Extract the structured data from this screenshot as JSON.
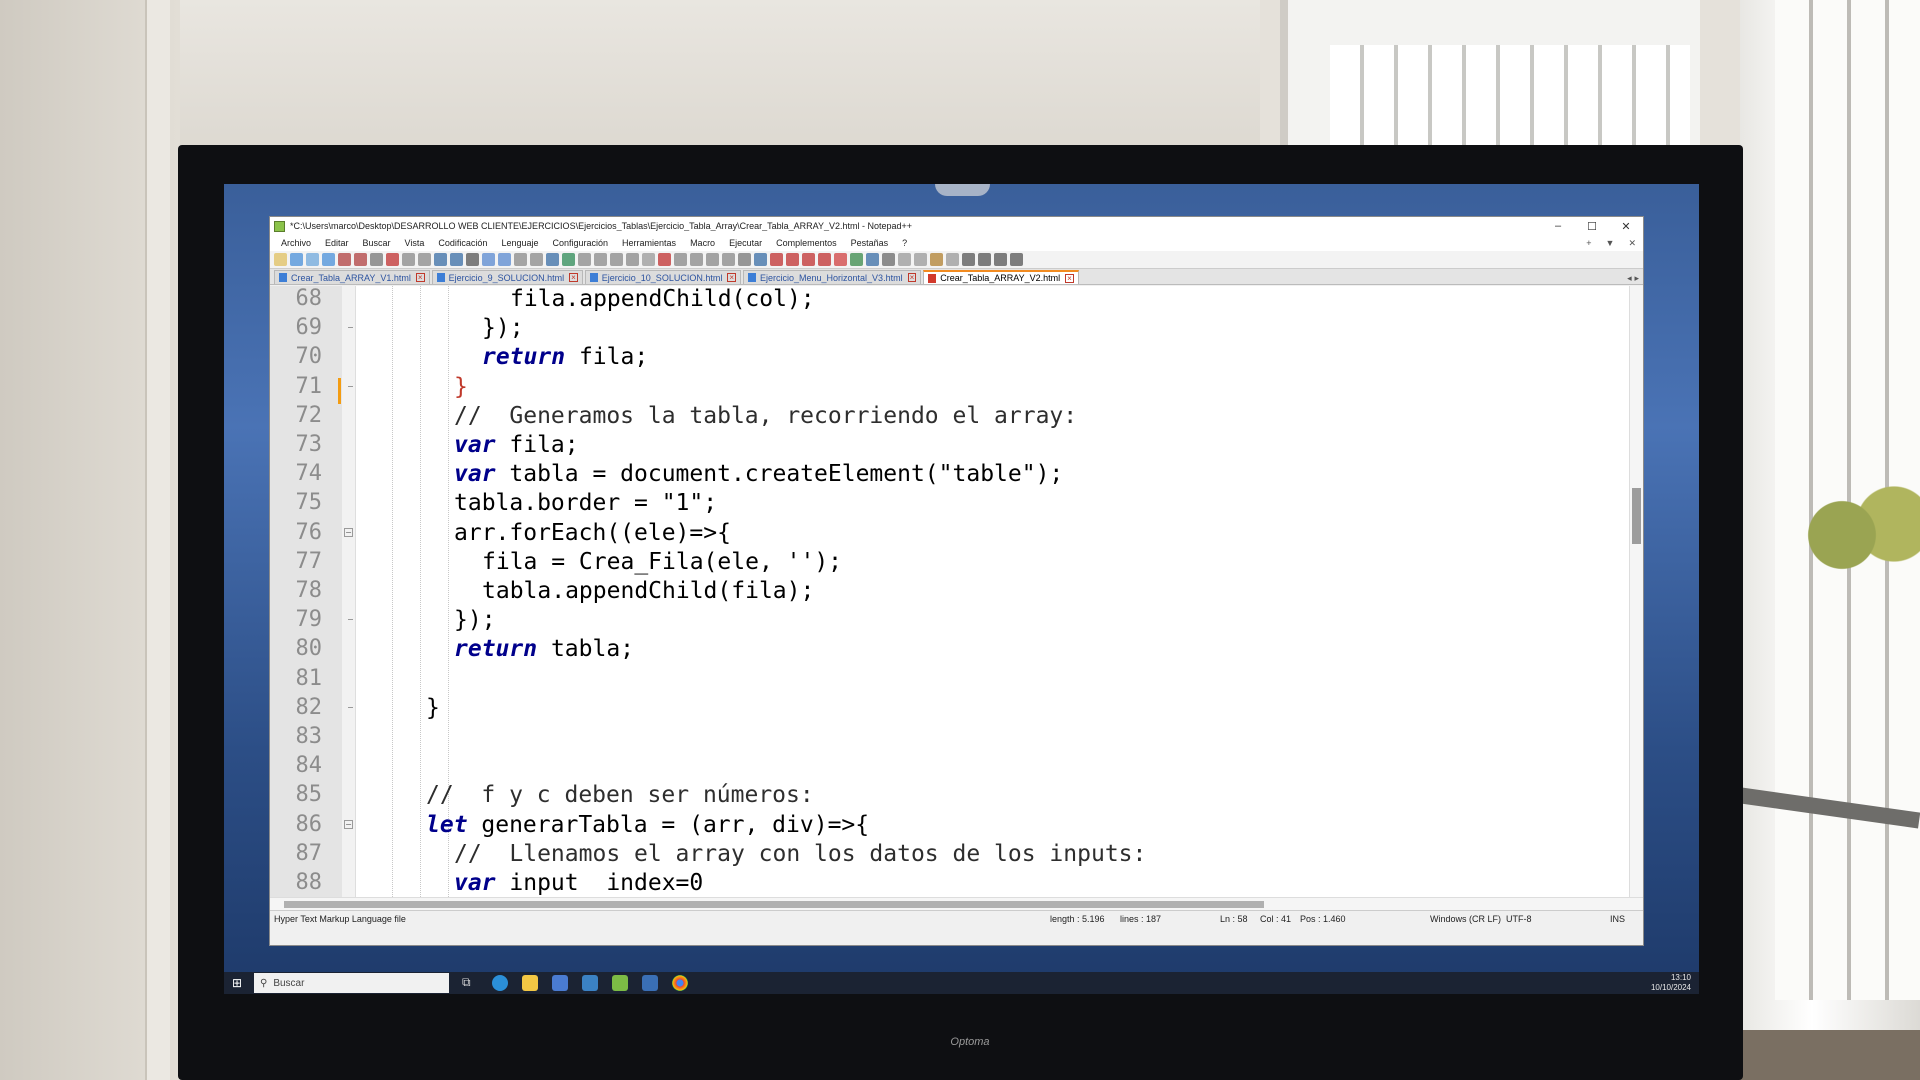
{
  "window": {
    "title": "*C:\\Users\\marco\\Desktop\\DESARROLLO WEB CLIENTE\\EJERCICIOS\\Ejercicios_Tablas\\Ejercicio_Tabla_Array\\Crear_Tabla_ARRAY_V2.html - Notepad++",
    "minimize": "–",
    "maximize": "☐",
    "close": "✕"
  },
  "menu": [
    "Archivo",
    "Editar",
    "Buscar",
    "Vista",
    "Codificación",
    "Lenguaje",
    "Configuración",
    "Herramientas",
    "Macro",
    "Ejecutar",
    "Complementos",
    "Pestañas",
    "?"
  ],
  "menu_right": [
    "+",
    "▼",
    "✕"
  ],
  "tabs": [
    {
      "label": "Crear_Tabla_ARRAY_V1.html",
      "active": false
    },
    {
      "label": "Ejercicio_9_SOLUCION.html",
      "active": false
    },
    {
      "label": "Ejercicio_10_SOLUCION.html",
      "active": false
    },
    {
      "label": "Ejercicio_Menu_Horizontal_V3.html",
      "active": false
    },
    {
      "label": "Crear_Tabla_ARRAY_V2.html",
      "active": true
    }
  ],
  "tab_nav": "◂ ▸",
  "code": [
    {
      "ln": "68",
      "indent": 3,
      "fold": "",
      "tokens": [
        {
          "t": "fila.appendChild(col);",
          "c": ""
        }
      ]
    },
    {
      "ln": "69",
      "indent": 2,
      "fold": "tick",
      "tokens": [
        {
          "t": "});",
          "c": ""
        }
      ]
    },
    {
      "ln": "70",
      "indent": 2,
      "fold": "",
      "tokens": [
        {
          "t": "return",
          "c": "kw"
        },
        {
          "t": " fila;",
          "c": ""
        }
      ]
    },
    {
      "ln": "71",
      "indent": 1,
      "fold": "tick",
      "tokens": [
        {
          "t": "}",
          "c": "brace-red"
        }
      ]
    },
    {
      "ln": "72",
      "indent": 1,
      "fold": "",
      "tokens": [
        {
          "t": "//  Generamos la tabla, recorriendo el array:",
          "c": "cm"
        }
      ]
    },
    {
      "ln": "73",
      "indent": 1,
      "fold": "",
      "tokens": [
        {
          "t": "var",
          "c": "kw"
        },
        {
          "t": " fila;",
          "c": ""
        }
      ]
    },
    {
      "ln": "74",
      "indent": 1,
      "fold": "",
      "tokens": [
        {
          "t": "var",
          "c": "kw"
        },
        {
          "t": " tabla = document.createElement(\"table\");",
          "c": ""
        }
      ]
    },
    {
      "ln": "75",
      "indent": 1,
      "fold": "",
      "tokens": [
        {
          "t": "tabla.border = \"1\";",
          "c": ""
        }
      ]
    },
    {
      "ln": "76",
      "indent": 1,
      "fold": "box",
      "tokens": [
        {
          "t": "arr.forEach((ele)=>{",
          "c": ""
        }
      ]
    },
    {
      "ln": "77",
      "indent": 2,
      "fold": "",
      "tokens": [
        {
          "t": "fila = Crea_Fila(ele, '');",
          "c": ""
        }
      ]
    },
    {
      "ln": "78",
      "indent": 2,
      "fold": "",
      "tokens": [
        {
          "t": "tabla.appendChild(fila);",
          "c": ""
        }
      ]
    },
    {
      "ln": "79",
      "indent": 1,
      "fold": "tick",
      "tokens": [
        {
          "t": "});",
          "c": ""
        }
      ]
    },
    {
      "ln": "80",
      "indent": 1,
      "fold": "",
      "tokens": [
        {
          "t": "return",
          "c": "kw"
        },
        {
          "t": " tabla;",
          "c": ""
        }
      ]
    },
    {
      "ln": "81",
      "indent": 0,
      "fold": "",
      "tokens": []
    },
    {
      "ln": "82",
      "indent": 0,
      "fold": "tick",
      "tokens": [
        {
          "t": "}",
          "c": ""
        }
      ]
    },
    {
      "ln": "83",
      "indent": 0,
      "fold": "",
      "tokens": []
    },
    {
      "ln": "84",
      "indent": 0,
      "fold": "",
      "tokens": []
    },
    {
      "ln": "85",
      "indent": 0,
      "fold": "",
      "tokens": [
        {
          "t": "//  f y c deben ser números:",
          "c": "cm"
        }
      ]
    },
    {
      "ln": "86",
      "indent": 0,
      "fold": "box",
      "tokens": [
        {
          "t": "let",
          "c": "kw"
        },
        {
          "t": " generarTabla = (arr, div)=>{",
          "c": ""
        }
      ]
    },
    {
      "ln": "87",
      "indent": 1,
      "fold": "",
      "tokens": [
        {
          "t": "//  Llenamos el array con los datos de los inputs:",
          "c": "cm"
        }
      ]
    },
    {
      "ln": "88",
      "indent": 1,
      "fold": "",
      "tokens": [
        {
          "t": "var",
          "c": "kw"
        },
        {
          "t": " input  index=0",
          "c": ""
        }
      ]
    }
  ],
  "status": {
    "file_type": "Hyper Text Markup Language file",
    "length": "length : 5.196",
    "lines": "lines : 187",
    "ln": "Ln : 58",
    "col": "Col : 41",
    "pos": "Pos : 1.460",
    "eol": "Windows (CR LF)",
    "encoding": "UTF-8",
    "mode": "INS"
  },
  "taskbar": {
    "search_placeholder": "Buscar",
    "time": "13:10",
    "date": "10/10/2024"
  },
  "monitor_brand": "Optoma",
  "colors": {
    "keyword": "#00008b",
    "active_tab_accent": "#f28b20",
    "desktop": "#4a73b5"
  }
}
